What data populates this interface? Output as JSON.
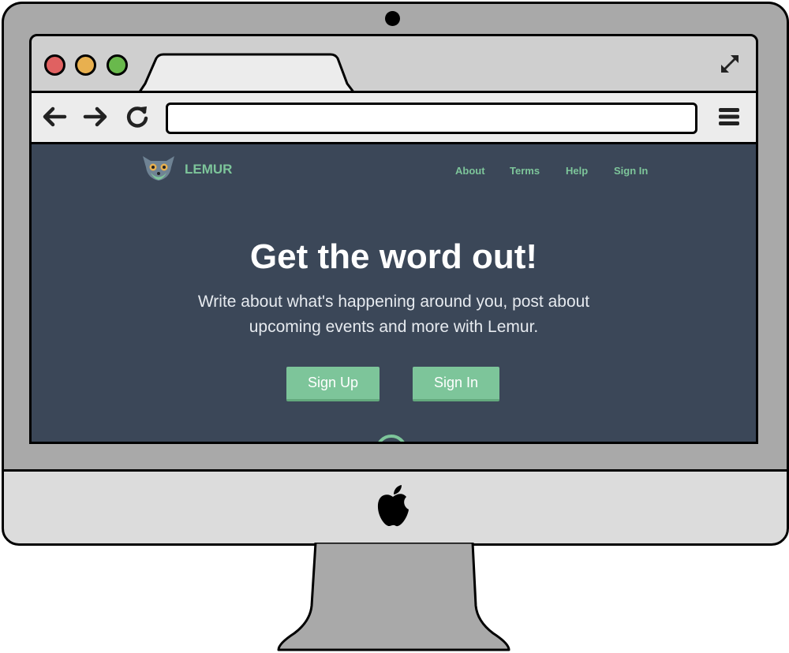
{
  "browser": {
    "window_controls": [
      "close",
      "minimize",
      "maximize"
    ],
    "nav_icons": [
      "back-arrow-icon",
      "forward-arrow-icon",
      "reload-icon",
      "hamburger-menu-icon",
      "expand-icon"
    ],
    "address_bar_value": ""
  },
  "site": {
    "brand": "LEMUR",
    "nav": [
      {
        "label": "About"
      },
      {
        "label": "Terms"
      },
      {
        "label": "Help"
      },
      {
        "label": "Sign In"
      }
    ],
    "hero": {
      "title": "Get the word out!",
      "subtitle": "Write about what's happening around you, post about upcoming events and more with Lemur.",
      "primary_button": "Sign Up",
      "secondary_button": "Sign In"
    }
  },
  "colors": {
    "page_bg": "#3b4758",
    "accent": "#7dc59a",
    "traffic_red": "#e06161",
    "traffic_yellow": "#e8b04f",
    "traffic_green": "#69b94c"
  }
}
